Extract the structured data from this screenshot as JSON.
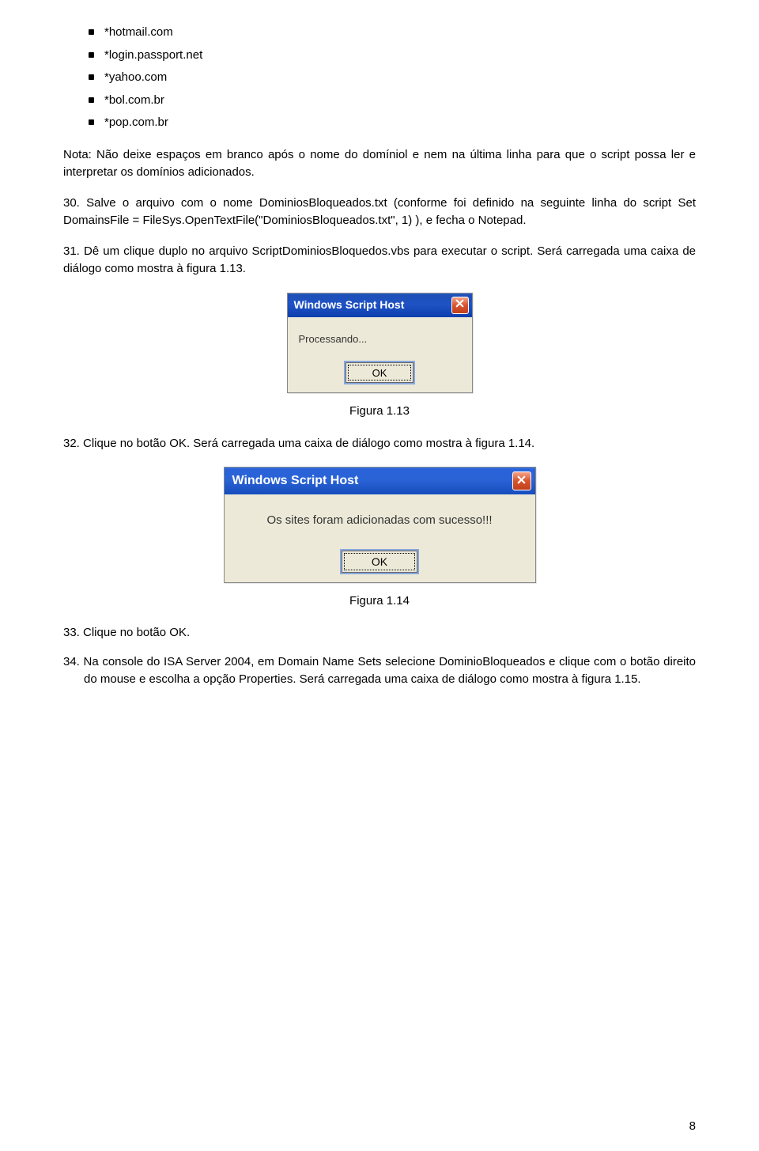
{
  "bullets": [
    "*hotmail.com",
    "*login.passport.net",
    "*yahoo.com",
    "*bol.com.br",
    "*pop.com.br"
  ],
  "note": "Nota: Não deixe espaços em branco após o nome do domíniol e nem na última linha para que o script possa ler e interpretar os domínios adicionados.",
  "step30": "30. Salve o arquivo com o nome DominiosBloqueados.txt (conforme foi definido na seguinte linha do script Set DomainsFile = FileSys.OpenTextFile(\"DominiosBloqueados.txt\", 1) ), e fecha o Notepad.",
  "step31": "31. Dê um clique duplo no arquivo ScriptDominiosBloquedos.vbs para executar o script. Será carregada uma caixa de diálogo como mostra à figura 1.13.",
  "dialog1": {
    "title": "Windows Script Host",
    "message": "Processando...",
    "ok": "OK"
  },
  "fig113": "Figura 1.13",
  "step32": "32. Clique no botão OK. Será carregada uma caixa de diálogo como mostra à figura 1.14.",
  "dialog2": {
    "title": "Windows Script Host",
    "message": "Os sites foram adicionadas com sucesso!!!",
    "ok": "OK"
  },
  "fig114": "Figura 1.14",
  "step33": "33. Clique no botão OK.",
  "step34": "34. Na console do ISA Server 2004, em Domain Name Sets selecione DominioBloqueados e clique com o botão direito do mouse e escolha a opção Properties. Será carregada uma caixa de diálogo como mostra à figura 1.15.",
  "pageNum": "8"
}
